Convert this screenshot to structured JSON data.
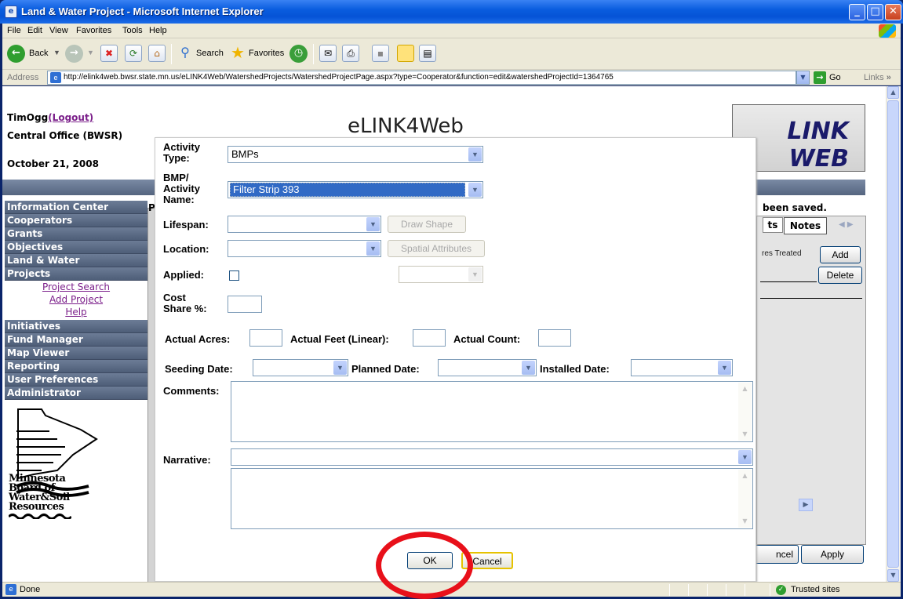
{
  "window": {
    "title": "Land & Water Project - Microsoft Internet Explorer",
    "controls": {
      "minimize": "_",
      "maximize": "□",
      "close": "✕"
    }
  },
  "menu": {
    "items": [
      "File",
      "Edit",
      "View",
      "Favorites",
      "Tools",
      "Help"
    ]
  },
  "toolbar": {
    "back_label": "Back",
    "search_label": "Search",
    "favorites_label": "Favorites"
  },
  "address": {
    "label": "Address",
    "url": "http://elink4web.bwsr.state.mn.us/eLINK4Web/WatershedProjects/WatershedProjectPage.aspx?type=Cooperator&function=edit&watershedProjectId=1364765",
    "go_label": "Go",
    "links_label": "Links"
  },
  "status": {
    "text": "Done",
    "zone": "Trusted sites"
  },
  "page": {
    "user": "TimOgg",
    "logout": "(Logout)",
    "office": "Central Office (BWSR)",
    "date": "October 21, 2008",
    "app_title": "eLINK4Web",
    "logo_text": "LINK WEB",
    "saved_message": "been saved.",
    "p_fragment": "P",
    "tabs": {
      "partial": "ts",
      "notes": "Notes"
    },
    "column_partial": "res Treated",
    "add_button": "Add",
    "delete_button": "Delete",
    "cancel_partial": "ncel",
    "apply_button": "Apply",
    "nav": [
      "Information Center",
      "Cooperators",
      "Grants",
      "Objectives",
      "Land & Water",
      "Projects"
    ],
    "nav_sub": [
      "Project Search",
      "Add Project",
      "Help"
    ],
    "nav_more": [
      "Initiatives",
      "Fund Manager",
      "Map Viewer",
      "Reporting",
      "User Preferences",
      "Administrator"
    ],
    "agency_logo": [
      "Minnesota",
      "Board of",
      "Water&Soil",
      "Resources"
    ]
  },
  "dialog": {
    "activity_type_label": "Activity Type:",
    "activity_type_value": "BMPs",
    "bmp_name_label": "BMP/ Activity Name:",
    "bmp_name_value": "Filter Strip 393",
    "lifespan_label": "Lifespan:",
    "lifespan_value": "",
    "draw_shape_button": "Draw Shape",
    "location_label": "Location:",
    "location_value": "",
    "spatial_attributes_button": "Spatial Attributes",
    "applied_label": "Applied:",
    "applied_checked": false,
    "cost_share_label": "Cost Share %:",
    "actual_acres_label": "Actual Acres:",
    "actual_feet_label": "Actual Feet (Linear):",
    "actual_count_label": "Actual Count:",
    "seeding_date_label": "Seeding Date:",
    "planned_date_label": "Planned Date:",
    "installed_date_label": "Installed Date:",
    "comments_label": "Comments:",
    "narrative_label": "Narrative:",
    "ok_button": "OK",
    "cancel_button": "Cancel"
  }
}
